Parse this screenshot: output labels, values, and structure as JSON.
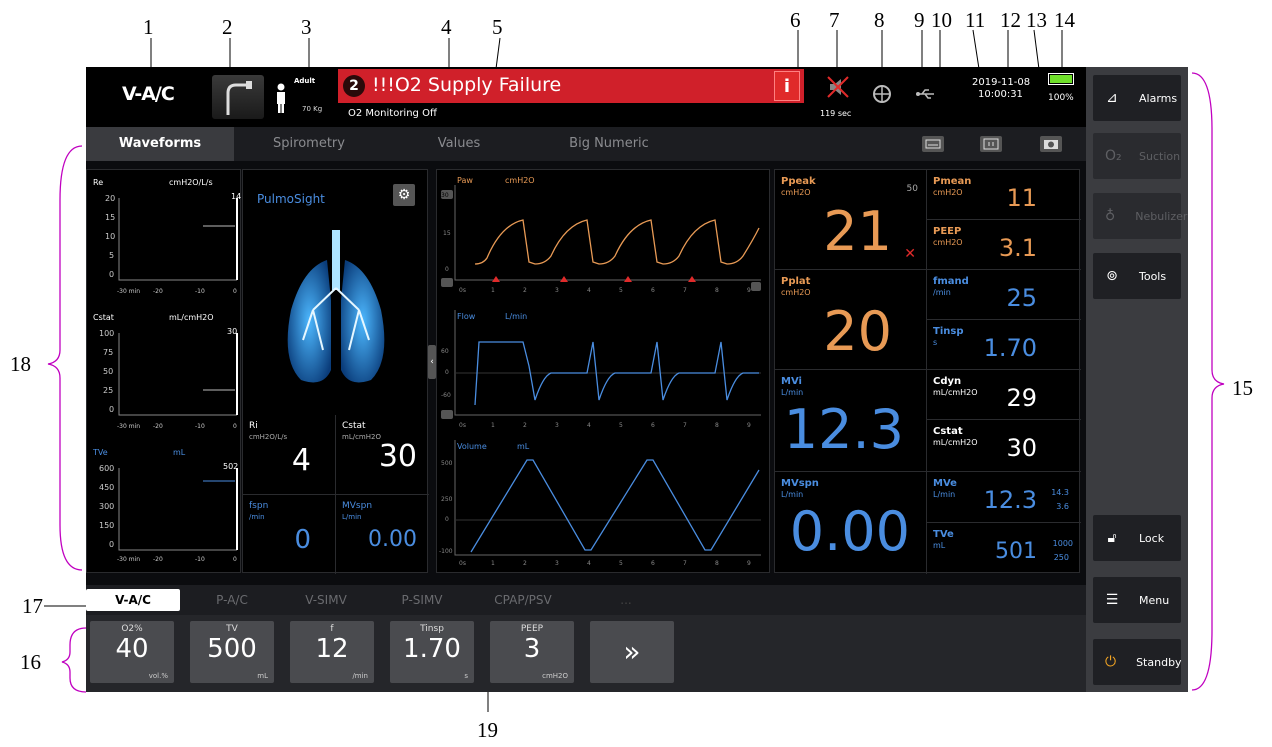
{
  "callouts": [
    "1",
    "2",
    "3",
    "4",
    "5",
    "6",
    "7",
    "8",
    "9",
    "10",
    "11",
    "12",
    "13",
    "14",
    "15",
    "16",
    "17",
    "18",
    "19"
  ],
  "topbar": {
    "mode": "V-A/C",
    "patient_type": "Adult",
    "weight": "70 Kg",
    "alarm_count": "2",
    "alarm_text": "!!!O2 Supply Failure",
    "prompt": "O2 Monitoring Off",
    "info_icon": "i",
    "silence_time": "119 sec",
    "date": "2019-11-08",
    "time": "10:00:31",
    "battery": "100%"
  },
  "tabs": [
    "Waveforms",
    "Spirometry",
    "Values",
    "Big Numeric"
  ],
  "trends": [
    {
      "name": "Re",
      "unit": "cmH2O/L/s",
      "current": "14",
      "yticks": [
        "20",
        "15",
        "10",
        "5",
        "0"
      ],
      "xticks": [
        "-30 min",
        "-20",
        "-10",
        "0"
      ]
    },
    {
      "name": "Cstat",
      "unit": "mL/cmH2O",
      "current": "30",
      "yticks": [
        "100",
        "75",
        "50",
        "25",
        "0"
      ],
      "xticks": [
        "-30 min",
        "-20",
        "-10",
        "0"
      ]
    },
    {
      "name": "TVe",
      "unit": "mL",
      "current": "502",
      "yticks": [
        "600",
        "450",
        "300",
        "150",
        "0"
      ],
      "xticks": [
        "-30 min",
        "-20",
        "-10",
        "0"
      ]
    }
  ],
  "pulmo": {
    "title": "PulmoSight",
    "cells": [
      {
        "name": "Ri",
        "unit": "cmH2O/L/s",
        "value": "4"
      },
      {
        "name": "Cstat",
        "unit": "mL/cmH2O",
        "value": "30"
      },
      {
        "name": "fspn",
        "unit": "/min",
        "value": "0"
      },
      {
        "name": "MVspn",
        "unit": "L/min",
        "value": "0.00"
      }
    ]
  },
  "waves": [
    {
      "name": "Paw",
      "unit": "cmH2O",
      "yticks": [
        "30",
        "15",
        "0"
      ]
    },
    {
      "name": "Flow",
      "unit": "L/min",
      "yticks": [
        "60",
        "0",
        "-60"
      ]
    },
    {
      "name": "Volume",
      "unit": "mL",
      "yticks": [
        "500",
        "250",
        "0",
        "-100"
      ]
    }
  ],
  "wave_xticks": [
    "0s",
    "1",
    "2",
    "3",
    "4",
    "5",
    "6",
    "7",
    "8",
    "9"
  ],
  "values": {
    "ppeak": {
      "name": "Ppeak",
      "unit": "cmH2O",
      "value": "21",
      "limit": "50"
    },
    "pplat": {
      "name": "Pplat",
      "unit": "cmH2O",
      "value": "20"
    },
    "mvi": {
      "name": "MVi",
      "unit": "L/min",
      "value": "12.3"
    },
    "mvspn": {
      "name": "MVspn",
      "unit": "L/min",
      "value": "0.00"
    },
    "small": [
      {
        "name": "Pmean",
        "unit": "cmH2O",
        "value": "11"
      },
      {
        "name": "PEEP",
        "unit": "cmH2O",
        "value": "3.1"
      },
      {
        "name": "fmand",
        "unit": "/min",
        "value": "25"
      },
      {
        "name": "Tinsp",
        "unit": "s",
        "value": "1.70"
      },
      {
        "name": "Cdyn",
        "unit": "mL/cmH2O",
        "value": "29"
      },
      {
        "name": "Cstat",
        "unit": "mL/cmH2O",
        "value": "30"
      }
    ],
    "mve": {
      "name": "MVe",
      "unit": "L/min",
      "value": "12.3",
      "high": "14.3",
      "low": "3.6"
    },
    "tve": {
      "name": "TVe",
      "unit": "mL",
      "value": "501",
      "high": "1000",
      "low": "250"
    }
  },
  "modes": [
    "V-A/C",
    "P-A/C",
    "V-SIMV",
    "P-SIMV",
    "CPAP/PSV",
    "..."
  ],
  "params": [
    {
      "name": "O2%",
      "value": "40",
      "unit": "vol.%"
    },
    {
      "name": "TV",
      "value": "500",
      "unit": "mL"
    },
    {
      "name": "f",
      "value": "12",
      "unit": "/min"
    },
    {
      "name": "Tinsp",
      "value": "1.70",
      "unit": "s"
    },
    {
      "name": "PEEP",
      "value": "3",
      "unit": "cmH2O"
    }
  ],
  "more": "»",
  "sidebar": {
    "alarms": "Alarms",
    "suction": "Suction",
    "nebulizer": "Nebulizer",
    "tools": "Tools",
    "lock": "Lock",
    "menu": "Menu",
    "standby": "Standby"
  },
  "colors": {
    "alarm": "#d0202a",
    "paw": "#e89a55",
    "flow": "#4a8de0",
    "accent": "#f5a623"
  }
}
